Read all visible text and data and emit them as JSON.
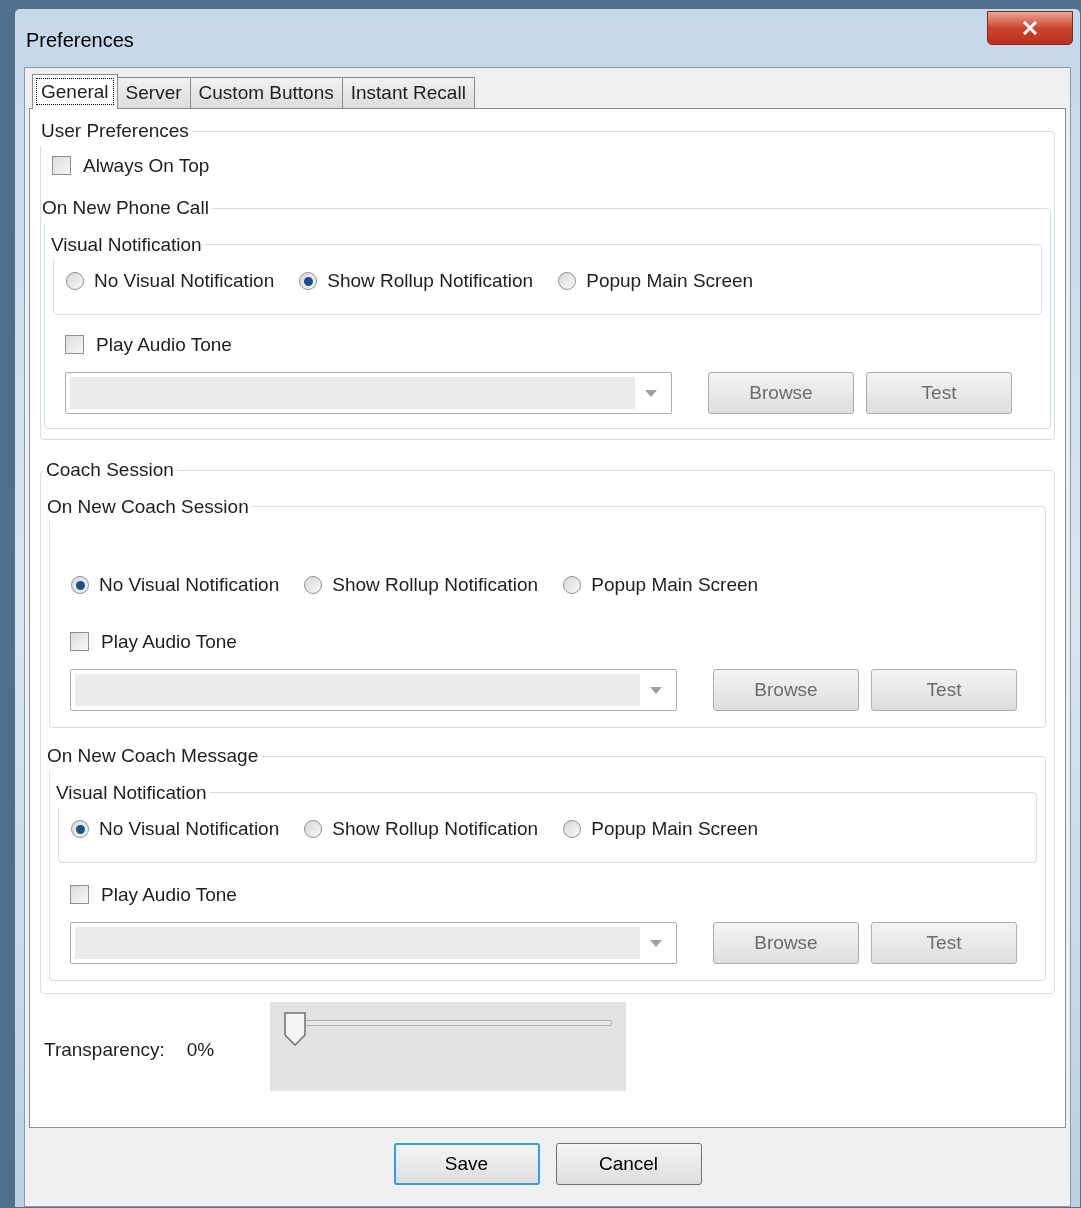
{
  "window": {
    "title": "Preferences"
  },
  "tabs": [
    {
      "label": "General",
      "selected": true
    },
    {
      "label": "Server",
      "selected": false
    },
    {
      "label": "Custom Buttons",
      "selected": false
    },
    {
      "label": "Instant Recall",
      "selected": false
    }
  ],
  "user_preferences": {
    "title": "User Preferences",
    "always_on_top": {
      "label": "Always On Top",
      "checked": false
    },
    "phone_call": {
      "title": "On New Phone Call",
      "visual": {
        "title": "Visual Notification",
        "options": [
          {
            "label": "No Visual Notification",
            "selected": false
          },
          {
            "label": "Show Rollup Notification",
            "selected": true
          },
          {
            "label": "Popup Main Screen",
            "selected": false
          }
        ]
      },
      "audio": {
        "label": "Play Audio Tone",
        "checked": false
      },
      "dropdown": {
        "disabled": true
      },
      "buttons": [
        {
          "label": "Browse",
          "disabled": true
        },
        {
          "label": "Test",
          "disabled": true
        }
      ]
    }
  },
  "coach_session": {
    "title": "Coach Session",
    "groups": [
      {
        "title": "On New Coach Session",
        "visual": {
          "options": [
            {
              "label": "No Visual Notification",
              "selected": true
            },
            {
              "label": "Show Rollup Notification",
              "selected": false
            },
            {
              "label": "Popup Main Screen",
              "selected": false
            }
          ]
        },
        "audio": {
          "label": "Play Audio Tone",
          "checked": false
        },
        "dropdown": {
          "disabled": true
        },
        "buttons": [
          {
            "label": "Browse",
            "disabled": true
          },
          {
            "label": "Test",
            "disabled": true
          }
        ]
      },
      {
        "title": "On New Coach Message",
        "visual": {
          "title": "Visual Notification",
          "options": [
            {
              "label": "No Visual Notification",
              "selected": true
            },
            {
              "label": "Show Rollup Notification",
              "selected": false
            },
            {
              "label": "Popup Main Screen",
              "selected": false
            }
          ]
        },
        "audio": {
          "label": "Play Audio Tone",
          "checked": false
        },
        "dropdown": {
          "disabled": true
        },
        "buttons": [
          {
            "label": "Browse",
            "disabled": true
          },
          {
            "label": "Test",
            "disabled": true
          }
        ]
      }
    ]
  },
  "transparency": {
    "label": "Transparency:",
    "value": "0%",
    "level": 0
  },
  "footer_buttons": [
    {
      "label": "Save",
      "default": true
    },
    {
      "label": "Cancel",
      "default": false
    }
  ]
}
